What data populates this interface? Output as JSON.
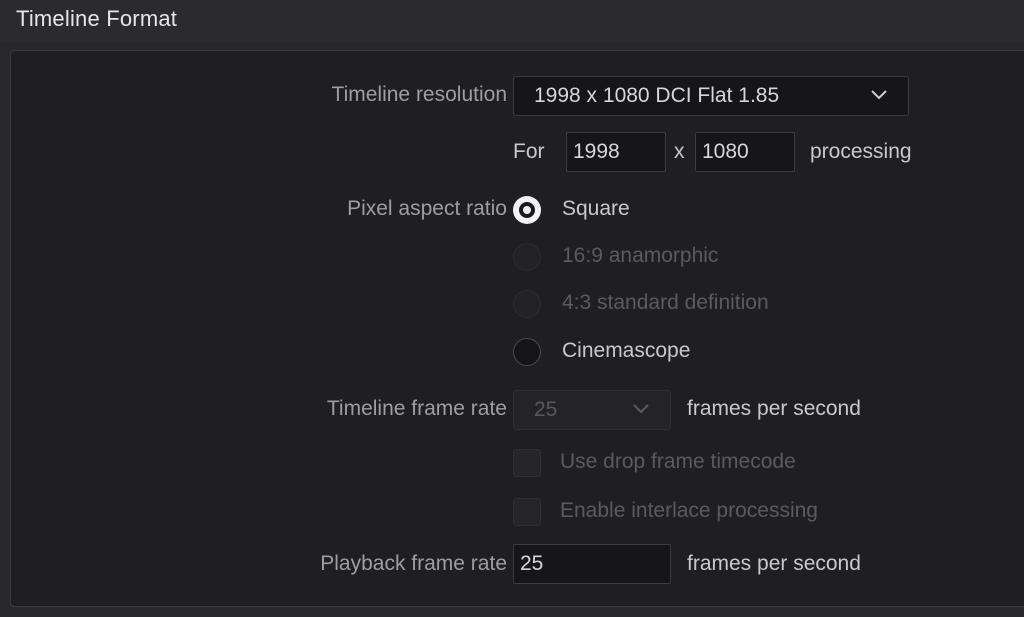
{
  "header": {
    "title": "Timeline Format"
  },
  "resolution": {
    "label": "Timeline resolution",
    "value": "1998 x 1080 DCI Flat 1.85",
    "for_label": "For",
    "width": "1998",
    "x_label": "x",
    "height": "1080",
    "processing_label": "processing"
  },
  "pixel_aspect": {
    "label": "Pixel aspect ratio",
    "options": [
      {
        "label": "Square",
        "selected": true,
        "enabled": true
      },
      {
        "label": "16:9 anamorphic",
        "selected": false,
        "enabled": false
      },
      {
        "label": "4:3 standard definition",
        "selected": false,
        "enabled": false
      },
      {
        "label": "Cinemascope",
        "selected": false,
        "enabled": true
      }
    ]
  },
  "frame_rate": {
    "label": "Timeline frame rate",
    "value": "25",
    "unit": "frames per second",
    "drop_frame_label": "Use drop frame timecode",
    "interlace_label": "Enable interlace processing"
  },
  "playback": {
    "label": "Playback frame rate",
    "value": "25",
    "unit": "frames per second"
  },
  "colors": {
    "panel_bg": "#1f1f23",
    "label": "#9d9da2",
    "disabled": "#5a5a5f"
  }
}
